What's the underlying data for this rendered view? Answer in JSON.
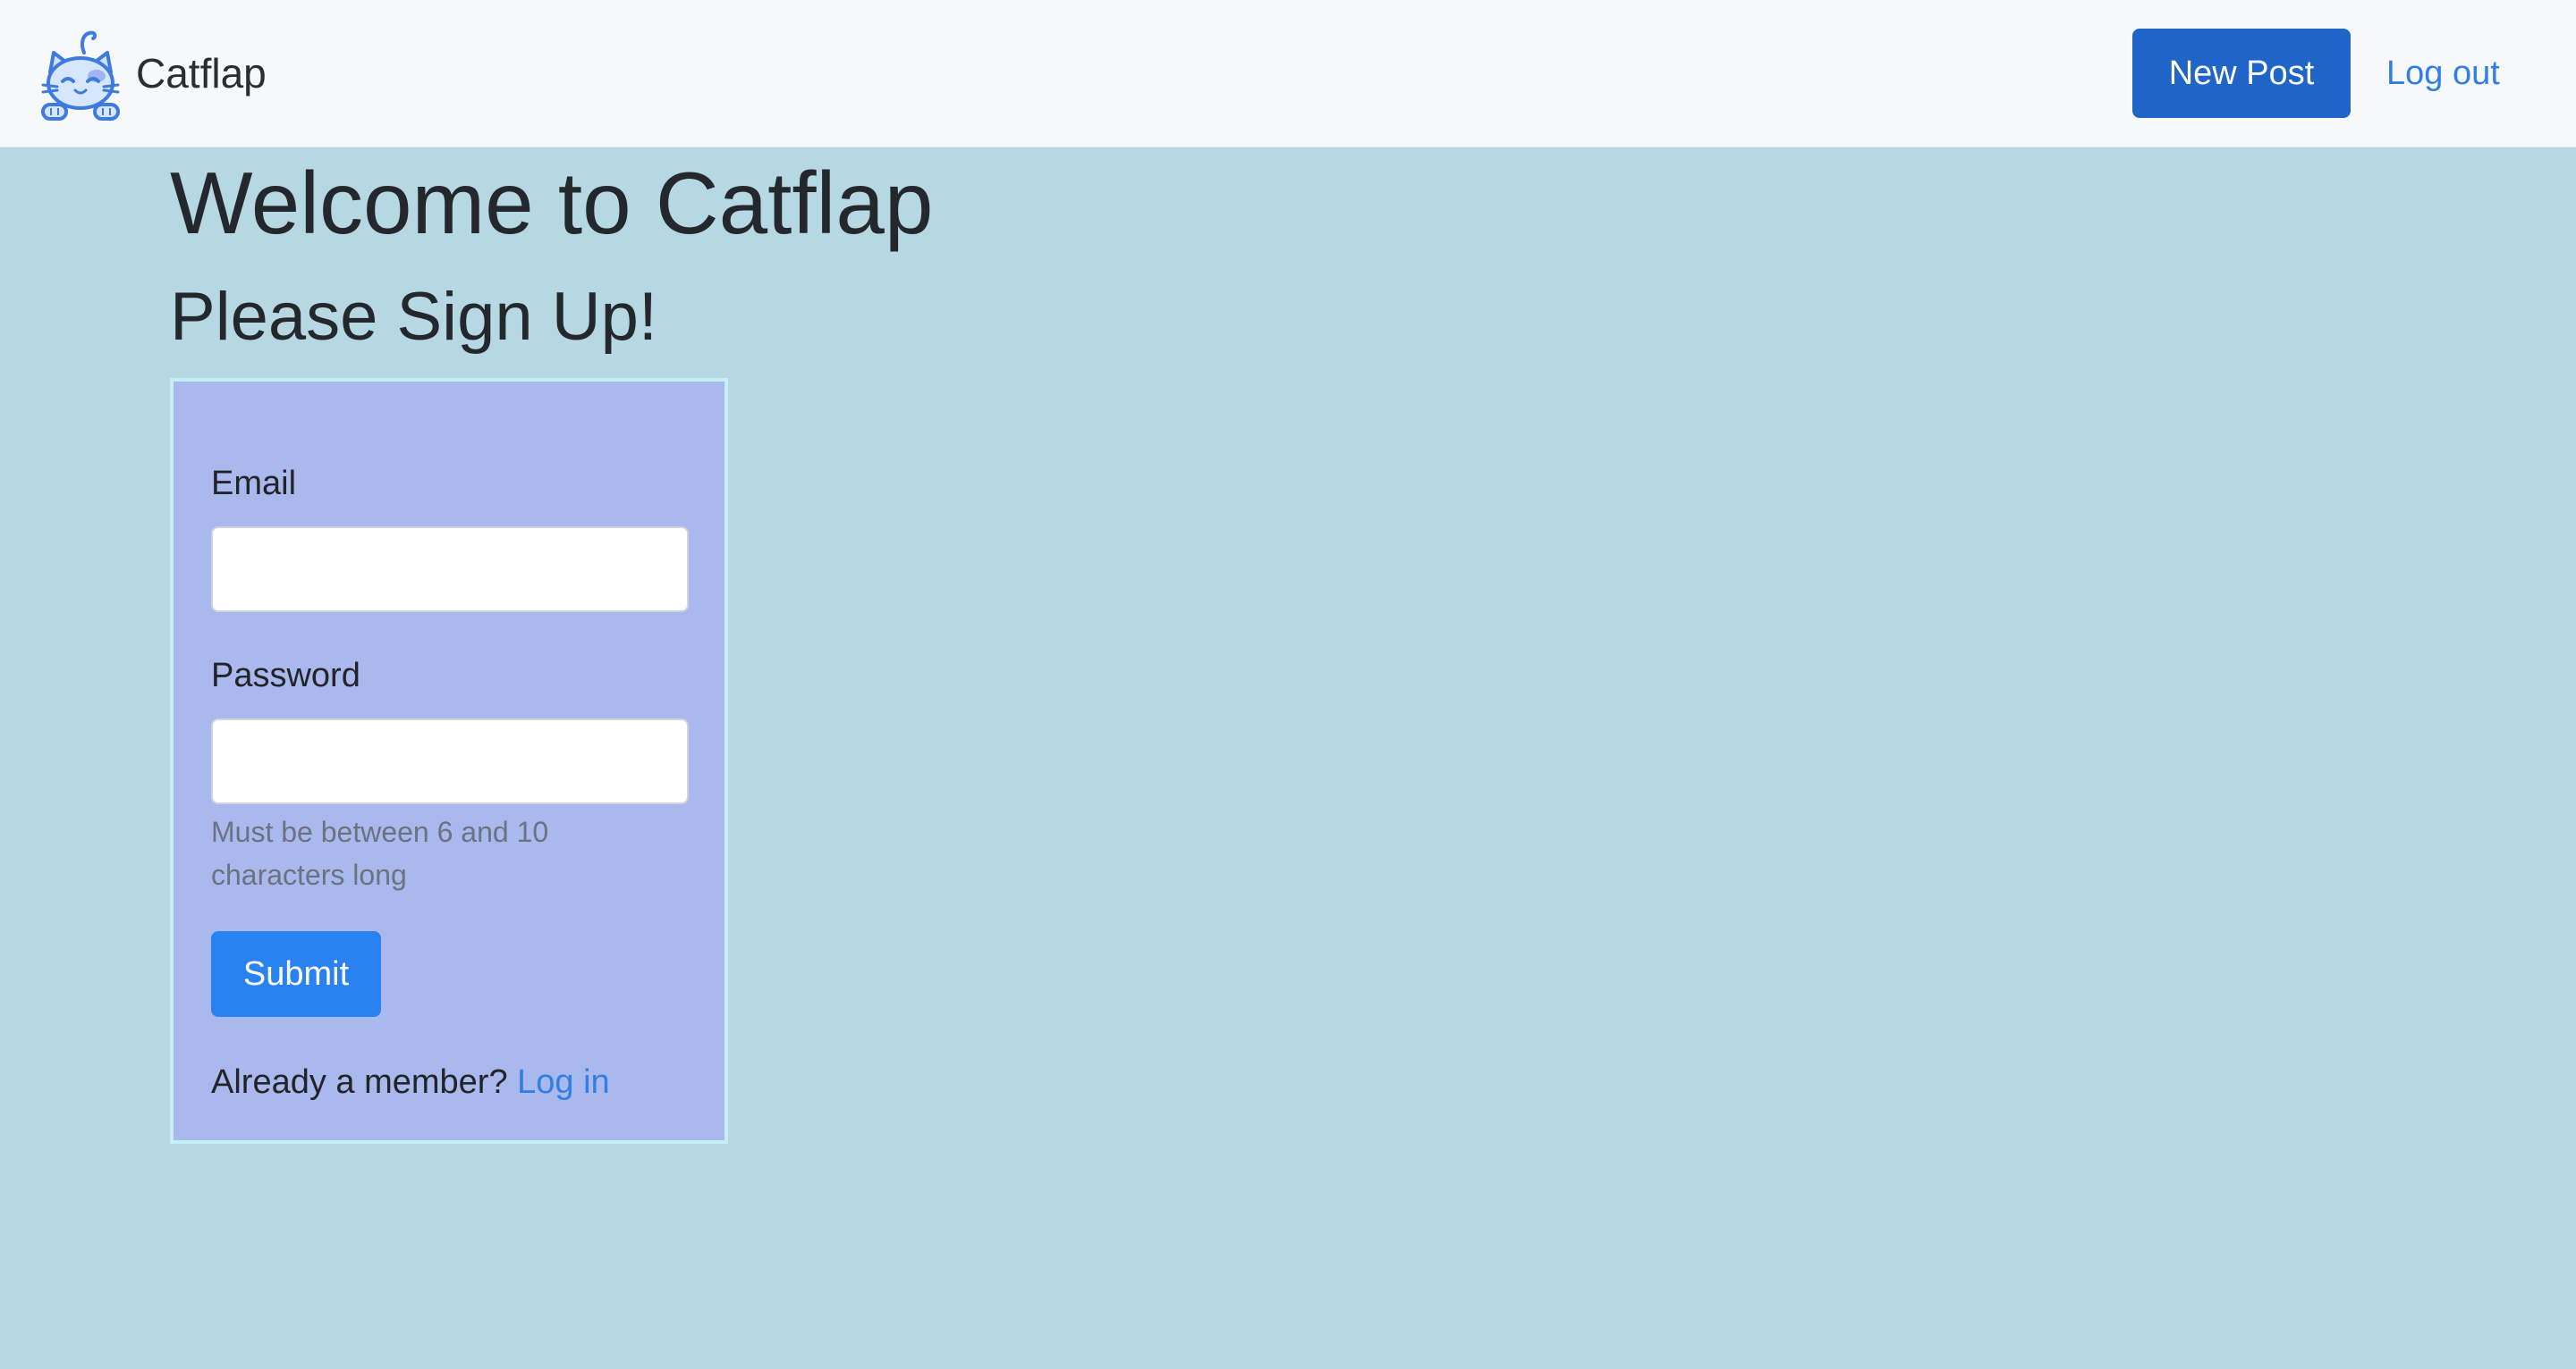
{
  "navbar": {
    "brand_name": "Catflap",
    "logo_icon": "cat-logo-icon",
    "new_post_label": "New Post",
    "logout_label": "Log out"
  },
  "main": {
    "welcome_heading": "Welcome to Catflap",
    "signup_heading": "Please Sign Up!"
  },
  "form": {
    "email_label": "Email",
    "email_value": "",
    "password_label": "Password",
    "password_value": "",
    "password_help": "Must be between 6 and 10 characters long",
    "submit_label": "Submit",
    "member_prompt": "Already a member?",
    "login_link_label": "Log in"
  },
  "colors": {
    "page_background": "#b5d8e3",
    "navbar_background": "#f7f8fa",
    "card_background": "#a9b9ee",
    "card_border": "#c4f0f5",
    "primary_button": "#1f64c7",
    "submit_button": "#2a82f0",
    "link": "#2f7fe6"
  }
}
